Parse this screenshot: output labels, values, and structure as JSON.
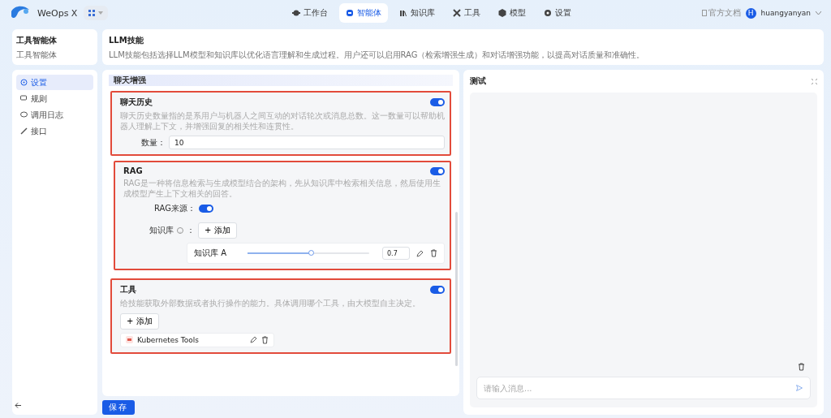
{
  "app": {
    "name": "WeOps X"
  },
  "nav": [
    {
      "label": "工作台",
      "selected": false
    },
    {
      "label": "智能体",
      "selected": true
    },
    {
      "label": "知识库",
      "selected": false
    },
    {
      "label": "工具",
      "selected": false
    },
    {
      "label": "模型",
      "selected": false
    },
    {
      "label": "设置",
      "selected": false
    }
  ],
  "account": {
    "docs": "官方文档",
    "avatar": "H",
    "user": "huangyanyan"
  },
  "agent": {
    "name": "工具智能体",
    "subtitle": "工具智能体"
  },
  "menu": [
    {
      "label": "设置",
      "selected": true
    },
    {
      "label": "规则",
      "selected": false
    },
    {
      "label": "调用日志",
      "selected": false
    },
    {
      "label": "接口",
      "selected": false
    }
  ],
  "skill": {
    "title": "LLM技能",
    "description": "LLM技能包括选择LLM模型和知识库以优化语言理解和生成过程。用户还可以启用RAG（检索增强生成）和对话增强功能，以提高对话质量和准确性。"
  },
  "section_title": "聊天增强",
  "chat_history": {
    "title": "聊天历史",
    "on": true,
    "description": "聊天历史数量指的是系用户与机器人之间互动的对话轮次或消息总数。这一数量可以帮助机器人理解上下文，并增强回复的相关性和连贯性。",
    "field_label": "数量：",
    "value": "10"
  },
  "rag": {
    "title": "RAG",
    "on": true,
    "description": "RAG是一种将信息检索与生成模型结合的架构，先从知识库中检索相关信息，然后使用生成模型产生上下文相关的回答。",
    "source_label": "RAG来源：",
    "source_on": true,
    "kb_label": "知识库",
    "kb_colon": "：",
    "add": "+ 添加",
    "items": [
      {
        "name": "知识库 A",
        "level": 0.53,
        "value": "0.7"
      }
    ]
  },
  "tools": {
    "title": "工具",
    "on": true,
    "description": "给技能获取外部数据或者执行操作的能力。具体调用哪个工具，由大模型自主决定。",
    "add": "+ 添加",
    "items": [
      {
        "name": "Kubernetes Tools"
      }
    ]
  },
  "save": "保存",
  "test": {
    "title": "测试",
    "placeholder": "请输入消息..."
  }
}
